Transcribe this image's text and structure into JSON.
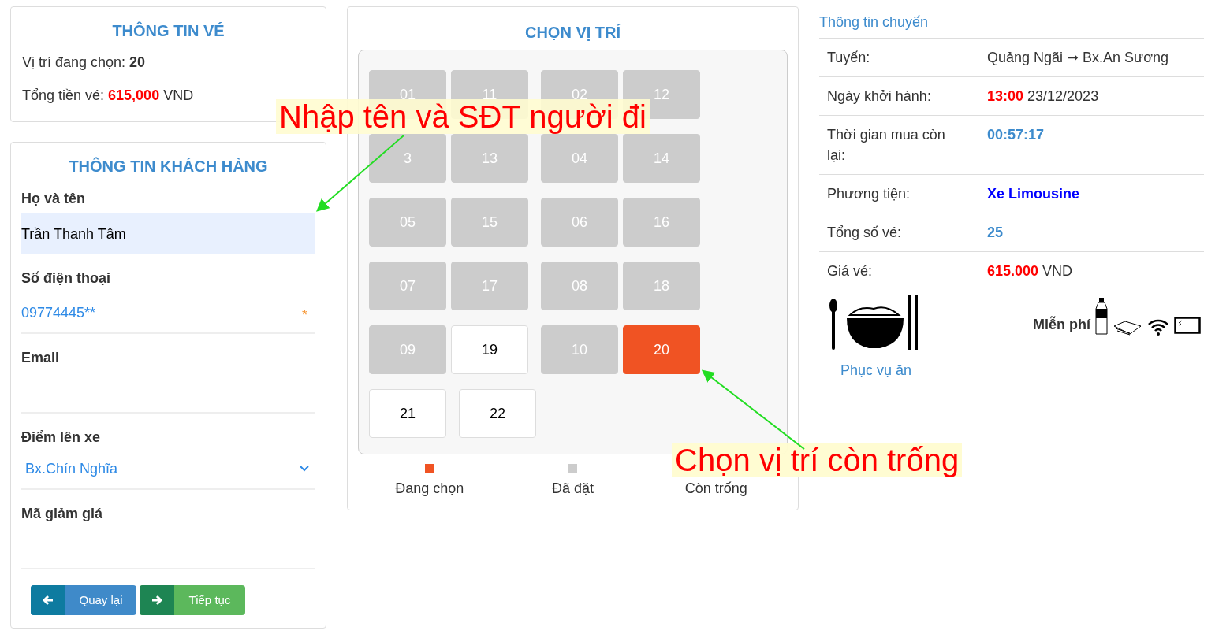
{
  "ticket_info": {
    "title": "THÔNG TIN VÉ",
    "selected_seat_label": "Vị trí đang chọn:",
    "selected_seat": "20",
    "total_label": "Tổng tiền vé:",
    "total_amount": "615,000",
    "total_currency": "VND"
  },
  "customer_form": {
    "title": "THÔNG TIN KHÁCH HÀNG",
    "fields": [
      {
        "kind": "text",
        "label": "Họ và tên",
        "value": "Trần Thanh Tâm",
        "autofilled": true
      },
      {
        "kind": "text",
        "label": "Số điện thoại",
        "value": "09774445**",
        "autofilled": false,
        "required_mark": "*"
      },
      {
        "kind": "text",
        "label": "Email",
        "autofilled": false
      },
      {
        "kind": "select",
        "label": "Điểm lên xe",
        "value": "Bx.Chín Nghĩa"
      },
      {
        "kind": "text",
        "label": "Mã giảm giá",
        "autofilled": false
      }
    ],
    "buttons": [
      {
        "kind": "back",
        "label": "Quay lại"
      },
      {
        "kind": "next",
        "label": "Tiếp tục"
      }
    ]
  },
  "seat_map": {
    "title": "CHỌN VỊ TRÍ",
    "rows": [
      [
        {
          "label": "01",
          "booked": true,
          "selected": false
        },
        {
          "label": "11",
          "booked": true,
          "selected": false
        },
        {
          "label": "02",
          "booked": true,
          "selected": false
        },
        {
          "label": "12",
          "booked": true,
          "selected": false
        }
      ],
      [
        {
          "label": "3",
          "booked": true,
          "selected": false
        },
        {
          "label": "13",
          "booked": true,
          "selected": false
        },
        {
          "label": "04",
          "booked": true,
          "selected": false
        },
        {
          "label": "14",
          "booked": true,
          "selected": false
        }
      ],
      [
        {
          "label": "05",
          "booked": true,
          "selected": false
        },
        {
          "label": "15",
          "booked": true,
          "selected": false
        },
        {
          "label": "06",
          "booked": true,
          "selected": false
        },
        {
          "label": "16",
          "booked": true,
          "selected": false
        }
      ],
      [
        {
          "label": "07",
          "booked": true,
          "selected": false
        },
        {
          "label": "17",
          "booked": true,
          "selected": false
        },
        {
          "label": "08",
          "booked": true,
          "selected": false
        },
        {
          "label": "18",
          "booked": true,
          "selected": false
        }
      ],
      [
        {
          "label": "09",
          "booked": true,
          "selected": false
        },
        {
          "label": "19",
          "booked": false,
          "selected": false
        },
        {
          "label": "10",
          "booked": true,
          "selected": false
        },
        {
          "label": "20",
          "booked": false,
          "selected": true
        }
      ],
      [
        {
          "label": "21",
          "booked": false,
          "selected": false
        },
        {
          "label": "22",
          "booked": false,
          "selected": false
        }
      ]
    ],
    "legend": [
      {
        "kind": "selected",
        "label": "Đang chọn"
      },
      {
        "kind": "booked",
        "label": "Đã đặt"
      },
      {
        "kind": "available",
        "label": "Còn trống"
      }
    ]
  },
  "trip_info": {
    "title": "Thông tin chuyến",
    "rows": [
      {
        "label": "Tuyến:",
        "value": "Quảng Ngãi ➞ Bx.An Sương",
        "kind": "route"
      },
      {
        "label": "Ngày khởi hành:",
        "value": "13:00",
        "kind": "departure",
        "suffix": "23/12/2023"
      },
      {
        "label": "Thời gian mua còn lại:",
        "value": "00:57:17",
        "kind": "countdown"
      },
      {
        "label": "Phương tiện:",
        "value": "Xe Limousine",
        "kind": "vehicle"
      },
      {
        "label": "Tổng số vé:",
        "value": "25",
        "kind": "count"
      },
      {
        "label": "Giá vé:",
        "value": "615.000",
        "kind": "price",
        "suffix": "VND"
      }
    ],
    "meal_label": "Phục vụ ăn",
    "free_label": "Miễn phí"
  },
  "annotations": [
    {
      "text": "Nhập tên và SĐT người đi"
    },
    {
      "text": "Chọn vị trí còn trống"
    }
  ]
}
